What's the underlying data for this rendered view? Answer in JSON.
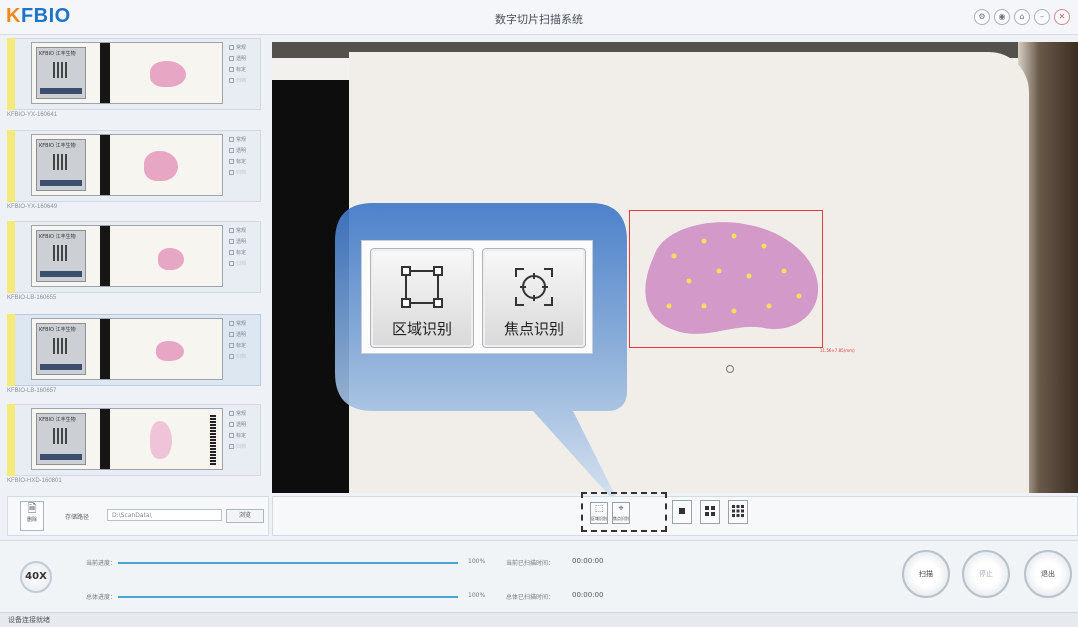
{
  "app": {
    "logo_k": "K",
    "logo_rest": "FBIO",
    "title": "数字切片扫描系统",
    "window_controls": [
      "settings-icon",
      "user-icon",
      "home-icon",
      "minimize-icon",
      "close-icon"
    ]
  },
  "slides": [
    {
      "id": "KFBIO-YX-160641",
      "label_text": "KFBIO 江丰生物",
      "options": [
        "常规",
        "透明",
        "标定",
        "归档"
      ]
    },
    {
      "id": "KFBIO-YX-160649",
      "label_text": "KFBIO 江丰生物",
      "options": [
        "常规",
        "透明",
        "标定",
        "归档"
      ]
    },
    {
      "id": "KFBIO-LB-160655",
      "label_text": "KFBIO 江丰生物",
      "options": [
        "常规",
        "透明",
        "标定",
        "归档"
      ]
    },
    {
      "id": "KFBIO-LB-160657",
      "label_text": "KFBIO 江丰生物",
      "options": [
        "常规",
        "透明",
        "标定",
        "归档"
      ]
    },
    {
      "id": "KFBIO-HXD-160801",
      "label_text": "KFBIO 江丰生物",
      "options": [
        "常规",
        "透明",
        "标定",
        "归档"
      ]
    }
  ],
  "sidebar_bottom": {
    "delete_label": "删除",
    "path_label": "存储路径",
    "path_value": "D:\\ScanData\\",
    "browse_label": "浏览"
  },
  "viewer": {
    "tumor_label": "11.56×7.85(mm)"
  },
  "callout": {
    "region_label": "区域识别",
    "focus_label": "焦点识别"
  },
  "toolbar": {
    "region_small": "区域识别",
    "focus_small": "焦点识别",
    "grid1": "■",
    "grid4": "▦",
    "grid9": "▦"
  },
  "progress": {
    "magnification": "40X",
    "current_label": "当前进度：",
    "current_pct": "100%",
    "current_time_label": "当前已扫描时间：",
    "current_time": "00:00:00",
    "total_label": "总体进度：",
    "total_pct": "100%",
    "total_time_label": "总体已扫描时间：",
    "total_time": "00:00:00"
  },
  "actions": {
    "scan": "扫描",
    "stop": "停止",
    "exit": "退出"
  },
  "status": "设备连接就绪",
  "colors": {
    "accent": "#1d74c8",
    "logo_orange": "#f08a1c",
    "progress": "#4aa3d8",
    "roi": "#e33b3b",
    "callout": "#7fa6d6"
  }
}
